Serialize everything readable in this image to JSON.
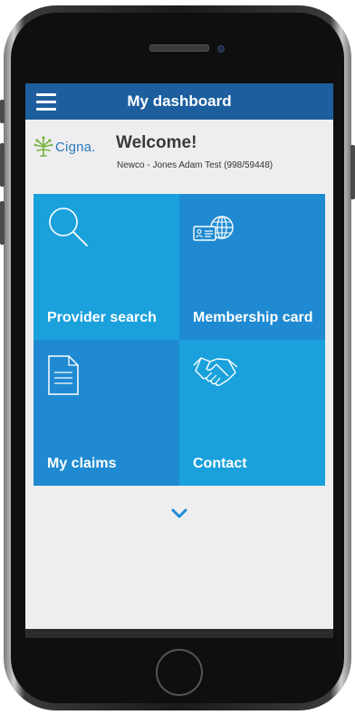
{
  "header": {
    "title": "My dashboard",
    "menu_icon": "hamburger-menu-icon"
  },
  "brand": {
    "logo_text": "Cigna.",
    "color": "#2a7ab8",
    "tree_color": "#7cb342"
  },
  "welcome": {
    "greeting": "Welcome!",
    "account": "Newco - Jones Adam Test (998/59448)"
  },
  "tiles": [
    {
      "label": "Provider search",
      "icon": "search-icon",
      "color": "#1aa1dc"
    },
    {
      "label": "Membership card",
      "icon": "id-card-globe-icon",
      "color": "#1f8ad1"
    },
    {
      "label": "My claims",
      "icon": "document-icon",
      "color": "#1f8ad1"
    },
    {
      "label": "Contact",
      "icon": "handshake-icon",
      "color": "#1aa1dc"
    }
  ],
  "more_icon": "chevron-down-icon",
  "colors": {
    "header": "#1d5f9e",
    "background": "#eeeef0",
    "accent": "#1d8ad6"
  }
}
